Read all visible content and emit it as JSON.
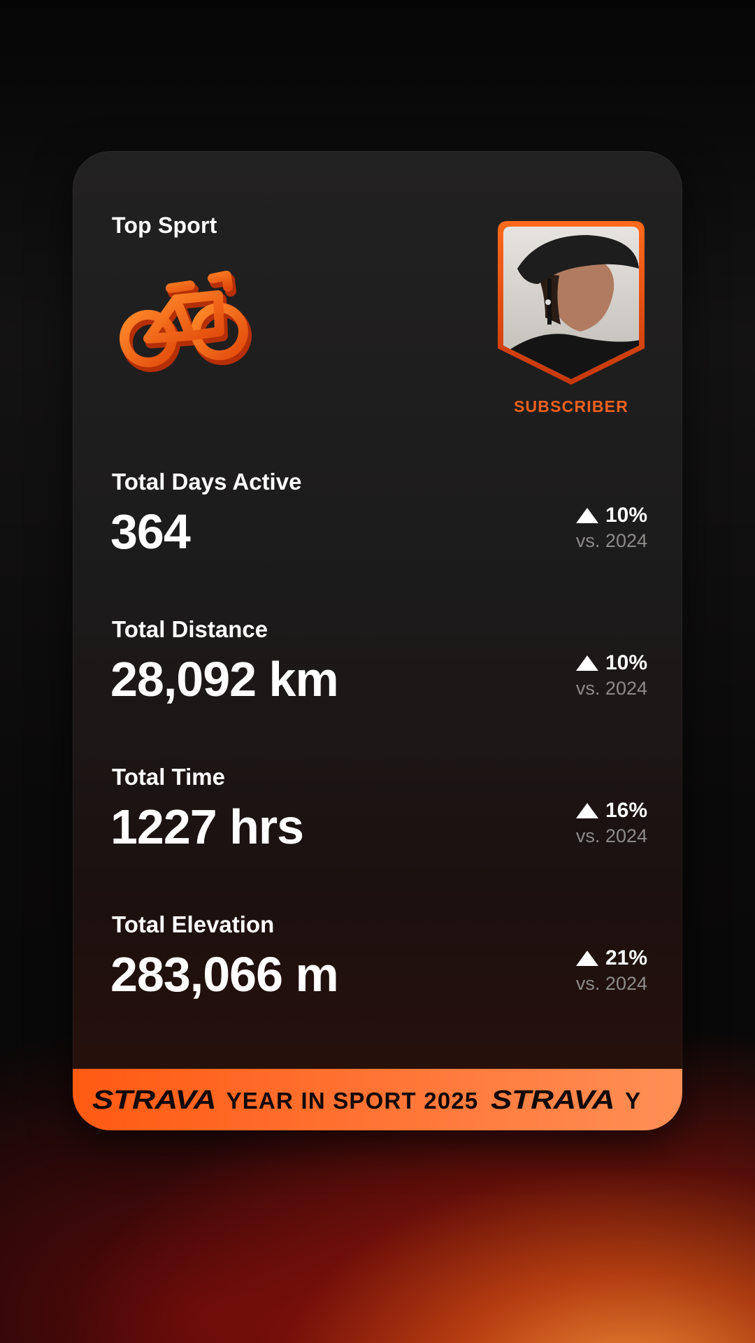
{
  "card": {
    "top_sport_label": "Top Sport",
    "sport_icon": "bike-icon",
    "avatar_status": "SUBSCRIBER"
  },
  "stats": [
    {
      "label": "Total Days Active",
      "value": "364",
      "change": "10%",
      "compare": "vs. 2024"
    },
    {
      "label": "Total Distance",
      "value": "28,092 km",
      "change": "10%",
      "compare": "vs. 2024"
    },
    {
      "label": "Total Time",
      "value": "1227 hrs",
      "change": "16%",
      "compare": "vs. 2024"
    },
    {
      "label": "Total Elevation",
      "value": "283,066 m",
      "change": "21%",
      "compare": "vs. 2024"
    }
  ],
  "banner": {
    "logo_1": "STRAVA",
    "text_1": "YEAR IN SPORT 2025",
    "logo_2": "STRAVA",
    "text_2": "Y"
  },
  "colors": {
    "accent": "#FC5200",
    "background": "#0A0A0A",
    "muted_text": "#8D8B8A"
  }
}
